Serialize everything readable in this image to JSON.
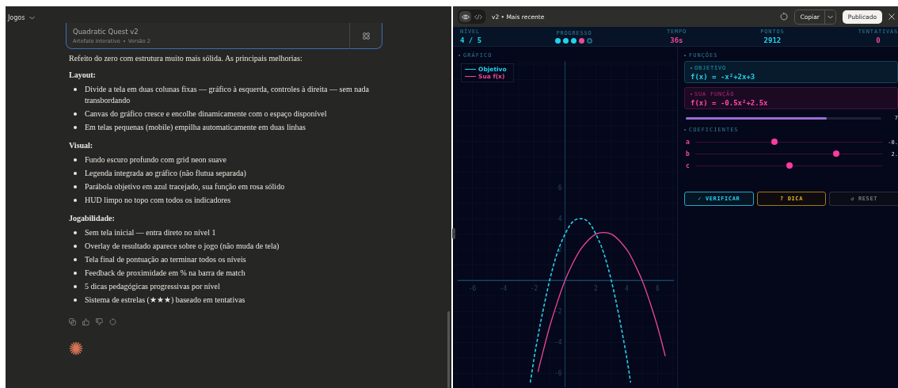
{
  "sidebar_header": {
    "title": "Jogos"
  },
  "artifact_card": {
    "title": "Quadratic Quest v2",
    "subtitle": "Artefato interativo",
    "version": "Versão 2"
  },
  "message": {
    "intro": "Refeito do zero com estrutura muito mais sólida. As principais melhorias:",
    "sections": [
      {
        "heading": "Layout:",
        "items": [
          "Divide a tela em duas colunas fixas — gráfico à esquerda, controles à direita — sem nada transbordando",
          "Canvas do gráfico cresce e encolhe dinamicamente com o espaço disponível",
          "Em telas pequenas (mobile) empilha automaticamente em duas linhas"
        ]
      },
      {
        "heading": "Visual:",
        "items": [
          "Fundo escuro profundo com grid neon suave",
          "Legenda integrada ao gráfico (não flutua separada)",
          "Parábola objetivo em azul tracejado, sua função em rosa sólido",
          "HUD limpo no topo com todos os indicadores"
        ]
      },
      {
        "heading": "Jogabilidade:",
        "items": [
          "Sem tela inicial — entra direto no nível 1",
          "Overlay de resultado aparece sobre o jogo (não muda de tela)",
          "Tela final de pontuação ao terminar todos os níveis",
          "Feedback de proximidade em % na barra de match",
          "5 dicas pedagógicas progressivas por nível",
          "Sistema de estrelas (★★★) baseado em tentativas"
        ]
      }
    ]
  },
  "preview_toolbar": {
    "view_toggle": [
      {
        "kind": "preview",
        "selected": true
      },
      {
        "kind": "code",
        "selected": false
      }
    ],
    "version": "v2 • Mais recente",
    "copy_button": "Copiar",
    "publish_button": "Publicado"
  },
  "hud": {
    "stats": [
      {
        "kind": "value",
        "label": "NÍVEL",
        "value": "4 / 5",
        "color": "#22d3ee"
      },
      {
        "kind": "dots",
        "label": "PROGRESSO",
        "dots": [
          {
            "filled": true,
            "color": "#22d3ee"
          },
          {
            "filled": true,
            "color": "#22d3ee"
          },
          {
            "filled": true,
            "color": "#22d3ee"
          },
          {
            "filled": true,
            "color": "#ec4899"
          },
          {
            "filled": false,
            "color": "#1e6a80"
          }
        ]
      },
      {
        "kind": "value",
        "label": "TEMPO",
        "value": "36s",
        "color": "#ec4899"
      },
      {
        "kind": "value",
        "label": "PONTOS",
        "value": "2912",
        "color": "#22d3ee"
      },
      {
        "kind": "value",
        "label": "TENTATIVAS",
        "value": "0",
        "color": "#ec4899"
      }
    ]
  },
  "graph": {
    "title": "GRÁFICO",
    "chart_data": {
      "type": "line",
      "grid": true,
      "x": [
        -2.25,
        -2,
        -1.75,
        -1.5,
        -1,
        -0.5,
        0,
        0.5,
        1,
        1.5,
        2,
        2.5,
        3,
        3.5,
        4,
        4.25,
        4.5,
        5,
        5.5,
        6,
        6.5
      ],
      "series": [
        {
          "name": "Objetivo",
          "color": "#22d3ee",
          "line_style": "dashed",
          "values": [
            -6.6,
            -5,
            -3.6,
            -2.3,
            0,
            1.8,
            3,
            3.8,
            4,
            3.8,
            3,
            1.8,
            0,
            -2.3,
            -5,
            -6.6,
            null,
            null,
            null,
            null,
            null
          ]
        },
        {
          "name": "Sua f(x)",
          "color": "#ec4899",
          "line_style": "solid",
          "values": [
            null,
            null,
            -5.9,
            -4.9,
            -3,
            -1.4,
            0,
            1.1,
            2,
            2.6,
            3,
            3.1,
            3,
            2.6,
            2,
            1.6,
            1.1,
            0,
            -1.4,
            -3,
            -4.9
          ]
        }
      ],
      "xlim": [
        -7.26,
        7.26
      ],
      "ylim": [
        -6.9,
        14.2
      ],
      "xticks": [
        -6,
        -4,
        -2,
        2,
        4,
        6
      ],
      "yticks": [
        -6,
        -4,
        -2,
        2,
        4,
        6
      ]
    }
  },
  "functions": {
    "title": "FUNÇÕES",
    "cards": [
      {
        "kind": "target",
        "label": "OBJETIVO",
        "formula": "f(x) = -x²+2x+3"
      },
      {
        "kind": "user",
        "label": "SUA FUNÇÃO",
        "formula": "f(x) = -0.5x²+2.5x"
      }
    ],
    "match": {
      "level": 0.72,
      "reading": "7"
    }
  },
  "coefficients": {
    "title": "COEFICIENTES",
    "sliders": [
      {
        "name": "a",
        "level": 0.42,
        "reading": "-0."
      },
      {
        "name": "b",
        "level": 0.75,
        "reading": "2."
      },
      {
        "name": "c",
        "level": 0.5
      }
    ]
  },
  "buttons": [
    {
      "kind": "primary",
      "label": "✓ VERIFICAR"
    },
    {
      "kind": "hint",
      "label": "? DICA"
    },
    {
      "kind": "reset",
      "label": "↺ RESET"
    }
  ]
}
